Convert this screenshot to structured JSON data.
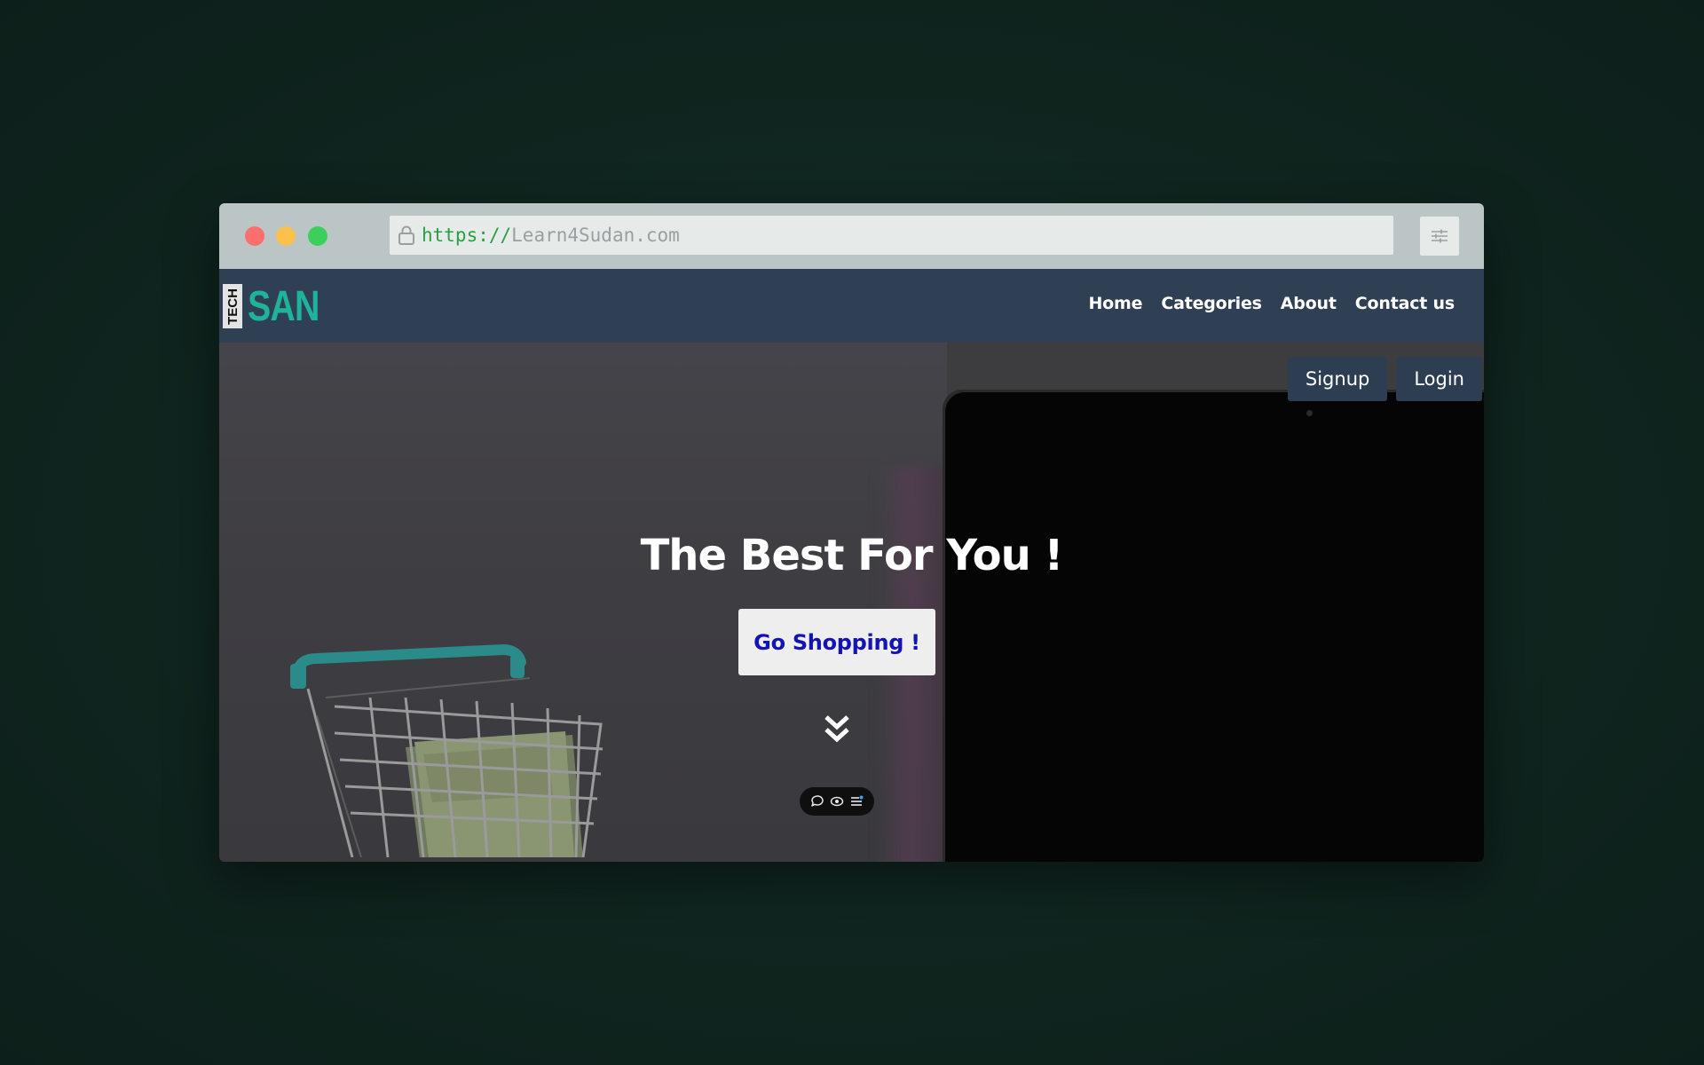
{
  "browser": {
    "url_scheme": "https://",
    "url_host": "Learn4Sudan.com"
  },
  "logo": {
    "tech": "TECH",
    "san": "SAN"
  },
  "nav": {
    "links": [
      "Home",
      "Categories",
      "About",
      "Contact us"
    ]
  },
  "auth": {
    "signup": "Signup",
    "login": "Login"
  },
  "hero": {
    "title": "The Best For You !",
    "cta": "Go Shopping !"
  },
  "icons": {
    "lock": "lock-icon",
    "settings": "sliders-icon",
    "scroll": "double-chevron-down-icon",
    "toolbar": [
      "comment-icon",
      "eye-icon",
      "list-icon"
    ]
  },
  "colors": {
    "navbar": "#2f3f54",
    "logo_accent": "#1fb39a",
    "cta_text": "#1414b4",
    "url_scheme": "#27a03e"
  }
}
